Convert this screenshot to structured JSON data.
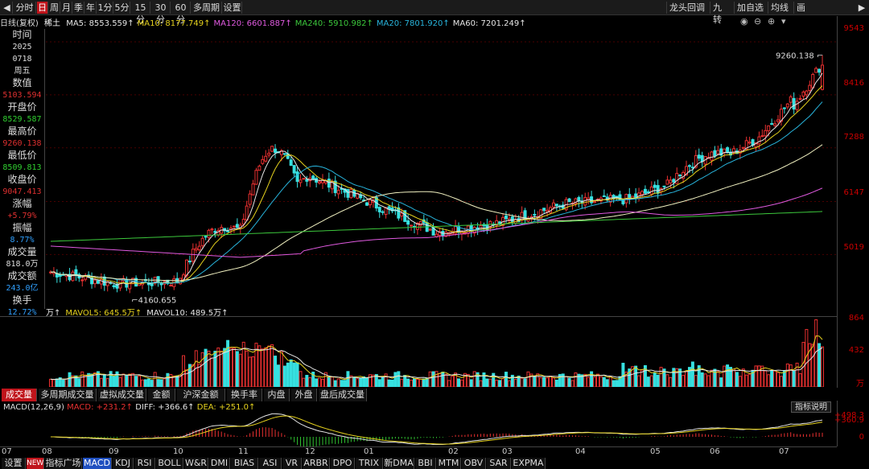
{
  "toolbar": {
    "nav_left": "◀",
    "nav_right": "▶",
    "periods": [
      "分时",
      "日",
      "周",
      "月",
      "季",
      "年",
      "1分",
      "5分",
      "15分",
      "30分",
      "60分",
      "多周期",
      "设置"
    ],
    "active_period": "日",
    "right_items": [
      "龙头回调",
      "九转",
      "加自选",
      "均线",
      "画"
    ],
    "right_icons": [
      "eye-icon",
      "minus-icon",
      "plus-icon",
      "dropdown-icon"
    ]
  },
  "ma_line": {
    "mode": "日线(复权)",
    "name": "稀土",
    "items": [
      {
        "label": "MA5: 8553.559↑",
        "color": "#e6e6e6"
      },
      {
        "label": "MA10: 8177.749↑",
        "color": "#e6d21e"
      },
      {
        "label": "MA120: 6601.887↑",
        "color": "#e05ae0"
      },
      {
        "label": "MA240: 5910.982↑",
        "color": "#3cc83c"
      },
      {
        "label": "MA20: 7801.920↑",
        "color": "#28b4dc"
      },
      {
        "label": "MA60: 7201.249↑",
        "color": "#e6e6e6"
      }
    ]
  },
  "info_panel": [
    {
      "label": "时间",
      "value": "2025",
      "color": "#dddddd"
    },
    {
      "label": "",
      "value": "0718",
      "color": "#dddddd"
    },
    {
      "label": "",
      "value": "周五",
      "color": "#dddddd"
    },
    {
      "label": "数值",
      "value": "5103.594",
      "color": "#e03030"
    },
    {
      "label": "开盘价",
      "value": "8529.587",
      "color": "#30d030"
    },
    {
      "label": "最高价",
      "value": "9260.138",
      "color": "#e03030"
    },
    {
      "label": "最低价",
      "value": "8509.813",
      "color": "#30d030"
    },
    {
      "label": "收盘价",
      "value": "9047.413",
      "color": "#e03030"
    },
    {
      "label": "涨幅",
      "value": "+5.79%",
      "color": "#e03030"
    },
    {
      "label": "振幅",
      "value": "8.77%",
      "color": "#30a0ff"
    },
    {
      "label": "成交量",
      "value": "818.0万",
      "color": "#dddddd"
    },
    {
      "label": "成交额",
      "value": "243.0亿",
      "color": "#30a0ff"
    },
    {
      "label": "换手",
      "value": "12.72%",
      "color": "#30a0ff"
    }
  ],
  "price_axis": [
    "9543",
    "8416",
    "7288",
    "6147",
    "5019"
  ],
  "annotations": {
    "high": "9260.138",
    "low": "4160.655"
  },
  "volume": {
    "header": [
      {
        "label": "万↑",
        "color": "#e6e6e6"
      },
      {
        "label": "MAVOL5: 645.5万↑",
        "color": "#e6d21e"
      },
      {
        "label": "MAVOL10: 489.5万↑",
        "color": "#e6e6e6"
      }
    ],
    "axis": [
      "864",
      "432",
      "万"
    ]
  },
  "indicator_tabs": [
    "成交量",
    "多周期成交量",
    "虚拟成交量",
    "金额",
    "沪深金额",
    "换手率",
    "内盘",
    "外盘",
    "盘后成交量"
  ],
  "active_indicator_tab": "成交量",
  "macd": {
    "title": "MACD(12,26,9)",
    "macd_value": "MACD: +231.2↑",
    "diff_value": "DIFF: +366.6↑",
    "dea_value": "DEA: +251.0↑",
    "explain_button": "指标说明",
    "axis": [
      "+498.3",
      "+360.9",
      "0"
    ]
  },
  "x_axis": [
    "07",
    "08",
    "09",
    "10",
    "11",
    "12",
    "01",
    "02",
    "03",
    "04",
    "05",
    "06",
    "07"
  ],
  "bottom_tabs": [
    "设置",
    "NEW",
    "指标广场",
    "MACD",
    "KDJ",
    "RSI",
    "BOLL",
    "W&R",
    "DMI",
    "BIAS",
    "ASI",
    "VR",
    "ARBR",
    "DPO",
    "TRIX",
    "新DMA",
    "BBI",
    "MTM",
    "OBV",
    "SAR",
    "EXPMA"
  ],
  "active_bottom_tab": "MACD",
  "colors": {
    "up": "#e83030",
    "down": "#36e0e0",
    "accent": "#c0141b"
  },
  "chart_data": {
    "type": "candlestick",
    "name": "稀土",
    "price_range": [
      4000,
      9543
    ],
    "monthly_closes": [
      {
        "month": "07",
        "close": 4650
      },
      {
        "month": "08",
        "close": 4400
      },
      {
        "month": "09",
        "close": 4450
      },
      {
        "month": "10",
        "close": 5600
      },
      {
        "month": "11",
        "close": 6700
      },
      {
        "month": "12",
        "close": 6100
      },
      {
        "month": "01",
        "close": 5500
      },
      {
        "month": "02",
        "close": 5700
      },
      {
        "month": "03",
        "close": 6100
      },
      {
        "month": "04",
        "close": 6200
      },
      {
        "month": "05",
        "close": 6700
      },
      {
        "month": "06",
        "close": 7500
      },
      {
        "month": "07",
        "close": 9047
      }
    ],
    "high": 9260.138,
    "low": 4160.655,
    "volume_max": 864,
    "macd_range": [
      -100,
      498.3
    ]
  }
}
